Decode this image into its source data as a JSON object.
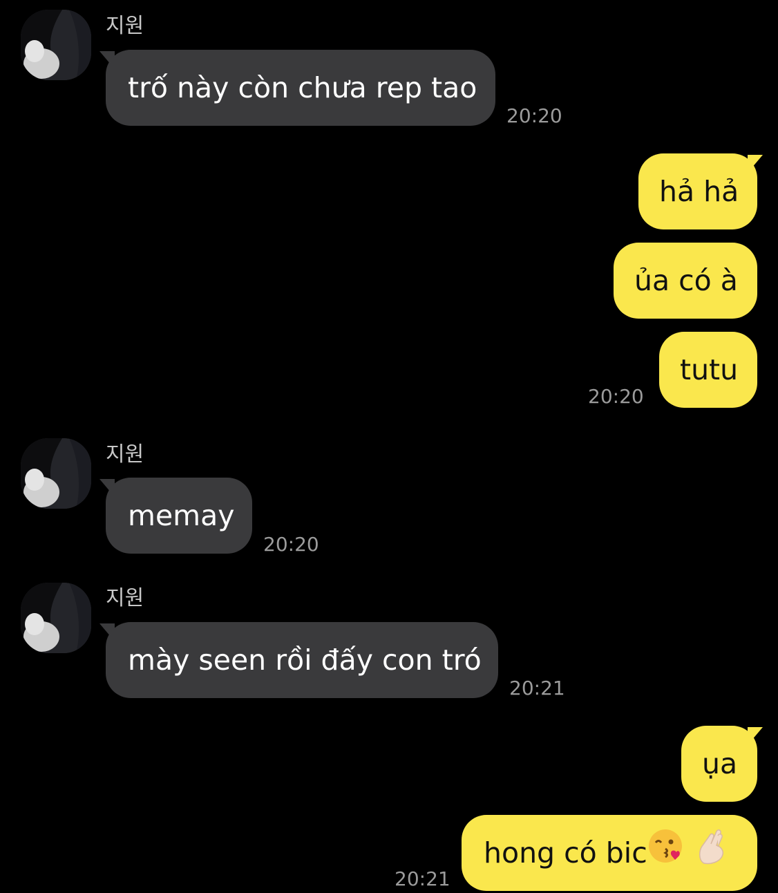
{
  "chat": {
    "contact_name": "지원",
    "messages": [
      {
        "from": "them",
        "text": "trố này còn chưa rep tao",
        "time": "20:20"
      },
      {
        "from": "me",
        "text": "hả hả"
      },
      {
        "from": "me",
        "text": "ủa có à"
      },
      {
        "from": "me",
        "text": "tutu",
        "time": "20:20"
      },
      {
        "from": "them",
        "text": "memay",
        "time": "20:20"
      },
      {
        "from": "them",
        "text": "mày seen rồi đấy con tró",
        "time": "20:21"
      },
      {
        "from": "me",
        "text": "ụa"
      },
      {
        "from": "me",
        "text": "hong có bic",
        "emojis": [
          "face-blowing-kiss-icon",
          "crossed-fingers-icon"
        ],
        "time": "20:21"
      }
    ]
  },
  "colors": {
    "background": "#000000",
    "incoming_bubble": "#3a3a3c",
    "outgoing_bubble": "#fae74d",
    "timestamp": "#9b9b9b"
  }
}
